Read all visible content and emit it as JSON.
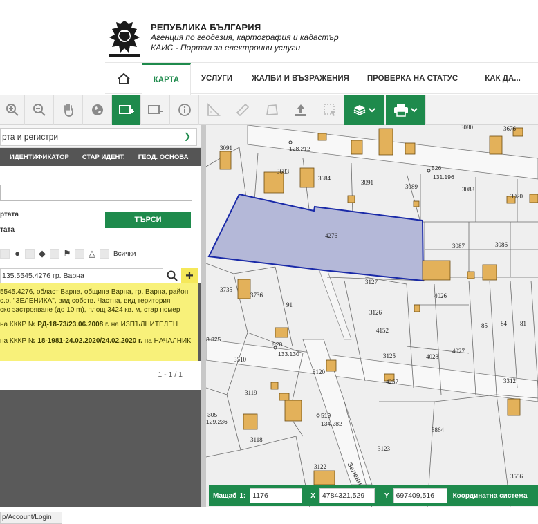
{
  "header": {
    "title": "РЕПУБЛИКА БЪЛГАРИЯ",
    "line1": "Агенция по геодезия, картография и кадастър",
    "line2": "КАИС - Портал за електронни услуги"
  },
  "nav": {
    "items": [
      {
        "label": "КАРТА",
        "active": true
      },
      {
        "label": "УСЛУГИ",
        "active": false
      },
      {
        "label": "ЖАЛБИ И ВЪЗРАЖЕНИЯ",
        "active": false
      },
      {
        "label": "ПРОВЕРКА НА СТАТУС",
        "active": false
      },
      {
        "label": "КАК ДА...",
        "active": false
      }
    ]
  },
  "toolbar": {
    "tools": [
      "zoom-in-icon",
      "zoom-out-icon",
      "pan-hand-icon",
      "globe-icon",
      "select-rectangle-icon",
      "select-area-icon",
      "info-icon",
      "measure-tool-icon",
      "ruler-icon",
      "polygon-measure-icon",
      "upload-icon",
      "selection-icon",
      "layers-icon",
      "print-icon"
    ]
  },
  "panel": {
    "layer_select": "рта и регистри",
    "tabs": [
      "ИДЕНТИФИКАТОР",
      "СТАР ИДЕНТ.",
      "ГЕОД. ОСНОВА"
    ],
    "search_value": "",
    "option1": "ртата",
    "option2": "тата",
    "search_button": "ТЪРСИ",
    "filter_all": "Всички",
    "result_field": "135.5545.4276 гр. Варна",
    "result_lines": [
      "5545.4276, област Варна, община Варна, гр. Варна, район",
      "с.о. \"ЗЕЛЕНИКА\", вид собств. Частна, вид територия",
      "ско застрояване (до 10 m), площ 3424 кв. м, стар номер"
    ],
    "order1_prefix": "на КККР №",
    "order1_num": "РД-18-73/23.06.2008 г.",
    "order1_suffix": "на ИЗПЪЛНИТЕЛЕН",
    "order2_prefix": "на КККР №",
    "order2_num": "18-1981-24.02.2020/24.02.2020 г.",
    "order2_suffix": "на НАЧАЛНИК",
    "pager": "1 - 1 / 1"
  },
  "map": {
    "selected_parcel": "4276",
    "parcels": [
      "3080",
      "3676",
      "3091",
      "3683",
      "3684",
      "3091",
      "3089",
      "3088",
      "3020",
      "3087",
      "3086",
      "3735",
      "3736",
      "91",
      "3127",
      "4026",
      "3126",
      "4152",
      "3125",
      "4028",
      "4027",
      "85",
      "84",
      "81",
      "3510",
      "3120",
      "4257",
      "3312",
      "3119",
      "3118",
      "3123",
      "3864",
      "3122",
      "3556"
    ],
    "points": [
      {
        "id": "128.212"
      },
      {
        "id": "526",
        "value": "131.196"
      },
      {
        "id": "520",
        "value": "133.130"
      },
      {
        "id": "519",
        "value": "134.282"
      },
      {
        "id": "129.236"
      },
      {
        "id": "3.825"
      },
      {
        "id": "305"
      }
    ],
    "street": "Зеленика"
  },
  "statusbar": {
    "scale_label": "Мащаб",
    "scale_prefix": "1:",
    "scale_value": "1176",
    "x_label": "X",
    "x_value": "4784321,529",
    "y_label": "Y",
    "y_value": "697409,516",
    "coord_label": "Координатна система"
  },
  "browser": {
    "status_url": "p/Account/Login"
  },
  "colors": {
    "accent": "#1e8a4c",
    "highlight": "#f8f17a",
    "parcel_selected": "#b4b8d8",
    "building": "#e3b15a"
  }
}
